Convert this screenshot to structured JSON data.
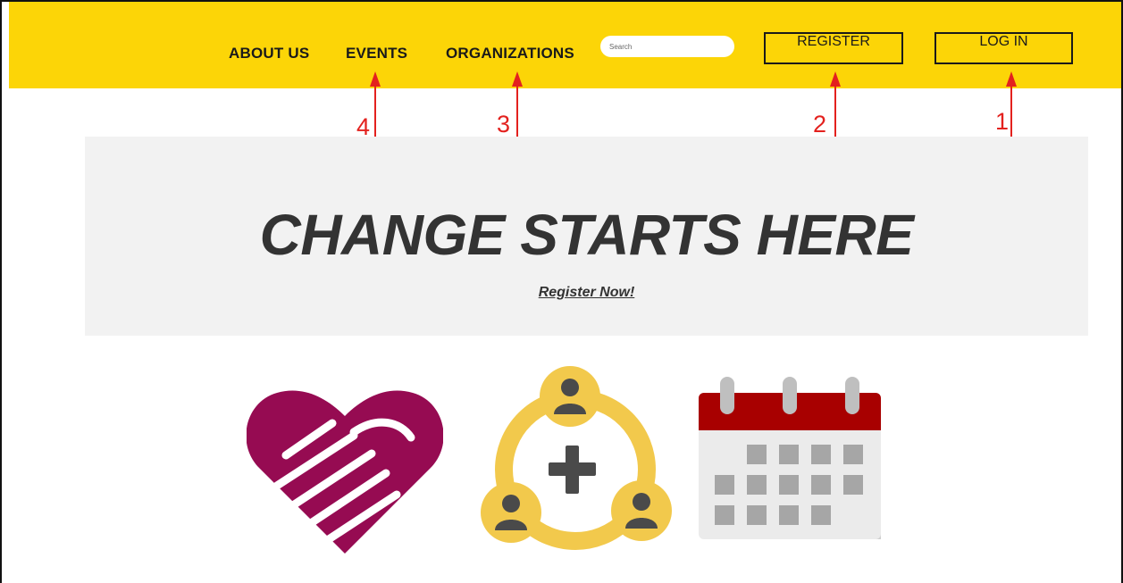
{
  "nav": {
    "links": [
      "ABOUT US",
      "EVENTS",
      "ORGANIZATIONS"
    ],
    "search_placeholder": "Search",
    "register_label": "REGISTER",
    "login_label": "LOG IN"
  },
  "annotations": [
    "1",
    "2",
    "3",
    "4"
  ],
  "hero": {
    "title": "CHANGE STARTS HERE",
    "cta": "Register Now!"
  },
  "icons": [
    "heart-handshake-icon",
    "community-network-icon",
    "calendar-icon"
  ],
  "colors": {
    "nav_bg": "#fcd507",
    "annotation": "#e3211e",
    "heart": "#960b52",
    "network": "#f2c94c",
    "calendar_top": "#a80000"
  }
}
